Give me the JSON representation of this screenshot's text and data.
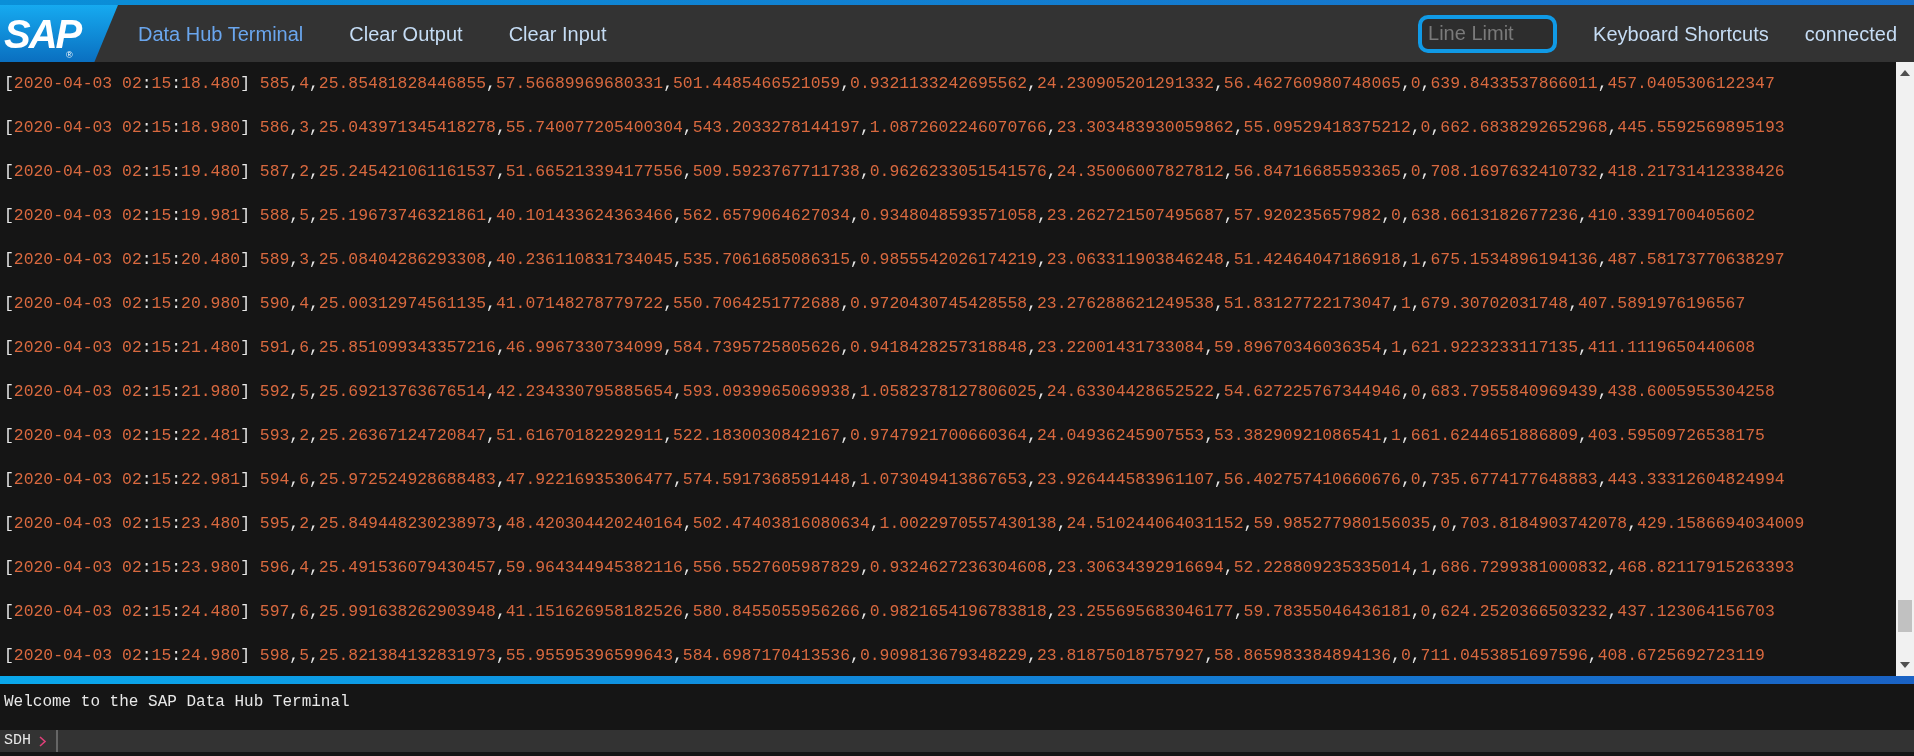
{
  "logo": {
    "text": "SAP",
    "mark": "®"
  },
  "nav": [
    {
      "label": "Data Hub Terminal",
      "selected": true
    },
    {
      "label": "Clear Output",
      "selected": false
    },
    {
      "label": "Clear Input",
      "selected": false
    }
  ],
  "line_limit": {
    "placeholder": "Line Limit"
  },
  "shortcuts_link": "Keyboard Shortcuts",
  "connection_status": "connected",
  "output_lines": [
    {
      "time": "[2020-04-03 02:15:18.480]",
      "data": "585,4,25.85481828446855,57.56689969680331,501.4485466521059,0.9321133242695562,24.230905201291332,56.462760980748065,0,639.8433537866011,457.0405306122347"
    },
    {
      "time": "[2020-04-03 02:15:18.980]",
      "data": "586,3,25.043971345418278,55.740077205400304,543.2033278144197,1.0872602246070766,23.303483930059862,55.09529418375212,0,662.6838292652968,445.5592569895193"
    },
    {
      "time": "[2020-04-03 02:15:19.480]",
      "data": "587,2,25.245421061161537,51.665213394177556,509.5923767711738,0.9626233051541576,24.35006007827812,56.84716685593365,0,708.1697632410732,418.21731412338426"
    },
    {
      "time": "[2020-04-03 02:15:19.981]",
      "data": "588,5,25.19673746321861,40.101433624363466,562.6579064627034,0.9348048593571058,23.262721507495687,57.920235657982,0,638.6613182677236,410.3391700405602"
    },
    {
      "time": "[2020-04-03 02:15:20.480]",
      "data": "589,3,25.08404286293308,40.236110831734045,535.7061685086315,0.9855542026174219,23.063311903846248,51.42464047186918,1,675.1534896194136,487.58173770638297"
    },
    {
      "time": "[2020-04-03 02:15:20.980]",
      "data": "590,4,25.00312974561135,41.07148278779722,550.7064251772688,0.9720430745428558,23.276288621249538,51.83127722173047,1,679.30702031748,407.5891976196567"
    },
    {
      "time": "[2020-04-03 02:15:21.480]",
      "data": "591,6,25.851099343357216,46.9967330734099,584.7395725805626,0.9418428257318848,23.22001431733084,59.89670346036354,1,621.9223233117135,411.1119650440608"
    },
    {
      "time": "[2020-04-03 02:15:21.980]",
      "data": "592,5,25.69213763676514,42.234330795885654,593.0939965069938,1.0582378127806025,24.63304428652522,54.627225767344946,0,683.7955840969439,438.6005955304258"
    },
    {
      "time": "[2020-04-03 02:15:22.481]",
      "data": "593,2,25.26367124720847,51.61670182292911,522.1830030842167,0.9747921700660364,24.04936245907553,53.38290921086541,1,661.6244651886809,403.59509726538175"
    },
    {
      "time": "[2020-04-03 02:15:22.981]",
      "data": "594,6,25.972524928688483,47.92216935306477,574.5917368591448,1.073049413867653,23.926444583961107,56.402757410660676,0,735.6774177648883,443.33312604824994"
    },
    {
      "time": "[2020-04-03 02:15:23.480]",
      "data": "595,2,25.849448230238973,48.420304420240164,502.47403816080634,1.0022970557430138,24.510244064031152,59.985277980156035,0,703.8184903742078,429.1586694034009"
    },
    {
      "time": "[2020-04-03 02:15:23.980]",
      "data": "596,4,25.491536079430457,59.964344945382116,556.5527605987829,0.9324627236304608,23.30634392916694,52.228809235335014,1,686.7299381000832,468.82117915263393"
    },
    {
      "time": "[2020-04-03 02:15:24.480]",
      "data": "597,6,25.991638262903948,41.151626958182526,580.8455055956266,0.9821654196783818,23.255695683046177,59.78355046436181,0,624.2520366503232,437.123064156703"
    },
    {
      "time": "[2020-04-03 02:15:24.980]",
      "data": "598,5,25.821384132831973,55.95595396599643,584.6987170413536,0.909813679348229,23.81875018757927,58.865983384894136,0,711.0453851697596,408.6725692723119"
    }
  ],
  "welcome": "Welcome to the SAP Data Hub Terminal",
  "prompt": "SDH"
}
